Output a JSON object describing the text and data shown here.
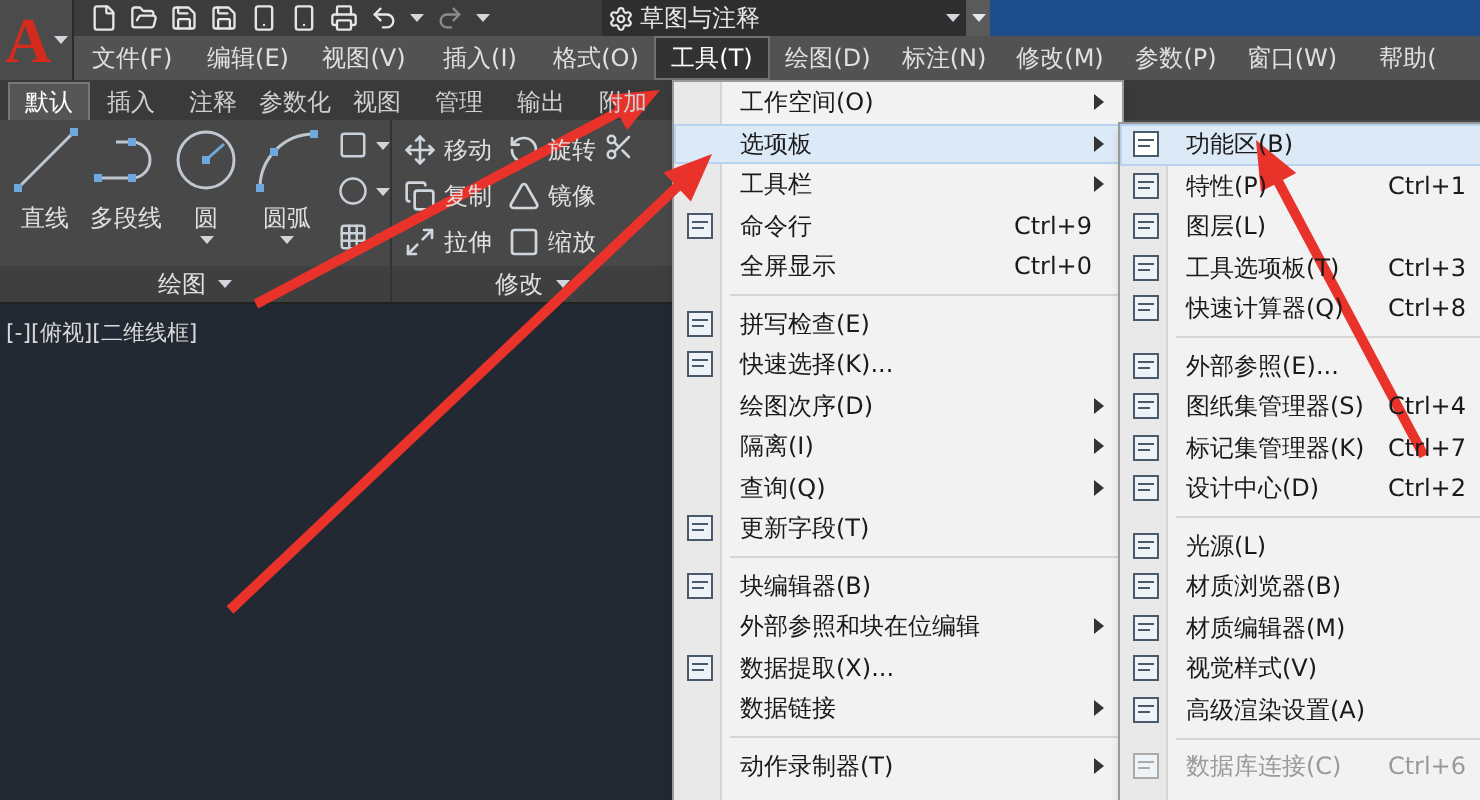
{
  "app_logo": "A",
  "workspace": "草图与注释",
  "menu_bar": [
    {
      "label": "文件(F)",
      "selected": false
    },
    {
      "label": "编辑(E)",
      "selected": false
    },
    {
      "label": "视图(V)",
      "selected": false
    },
    {
      "label": "插入(I)",
      "selected": false
    },
    {
      "label": "格式(O)",
      "selected": false
    },
    {
      "label": "工具(T)",
      "selected": true
    },
    {
      "label": "绘图(D)",
      "selected": false
    },
    {
      "label": "标注(N)",
      "selected": false
    },
    {
      "label": "修改(M)",
      "selected": false
    },
    {
      "label": "参数(P)",
      "selected": false
    },
    {
      "label": "窗口(W)",
      "selected": false
    },
    {
      "label": "帮助(",
      "selected": false
    }
  ],
  "ribbon_tabs": [
    {
      "label": "默认",
      "selected": true
    },
    {
      "label": "插入",
      "selected": false
    },
    {
      "label": "注释",
      "selected": false
    },
    {
      "label": "参数化",
      "selected": false
    },
    {
      "label": "视图",
      "selected": false
    },
    {
      "label": "管理",
      "selected": false
    },
    {
      "label": "输出",
      "selected": false
    },
    {
      "label": "附加",
      "selected": false
    }
  ],
  "draw_panel": {
    "title": "绘图",
    "large_tools": [
      {
        "kind": "line",
        "label": "直线",
        "dropdown": false
      },
      {
        "kind": "polyline",
        "label": "多段线",
        "dropdown": false
      },
      {
        "kind": "circle",
        "label": "圆",
        "dropdown": true
      },
      {
        "kind": "arc",
        "label": "圆弧",
        "dropdown": true
      }
    ]
  },
  "modify_panel": {
    "title": "修改",
    "tools": [
      {
        "kind": "move",
        "label": "移动"
      },
      {
        "kind": "rotate",
        "label": "旋转"
      },
      {
        "kind": "copy",
        "label": "复制"
      },
      {
        "kind": "mirror",
        "label": "镜像"
      },
      {
        "kind": "stretch",
        "label": "拉伸"
      },
      {
        "kind": "scale",
        "label": "缩放"
      }
    ]
  },
  "viewport_label": "[-][俯视][二维线框]",
  "tools_menu": {
    "groups": [
      [
        {
          "label": "工作空间(O)",
          "submenu": true,
          "has_icon": false,
          "selected": false,
          "disabled": false
        },
        {
          "label": "选项板",
          "submenu": true,
          "has_icon": false,
          "selected": true,
          "disabled": false
        },
        {
          "label": "工具栏",
          "submenu": true,
          "has_icon": false,
          "selected": false,
          "disabled": false
        },
        {
          "label": "命令行",
          "shortcut": "Ctrl+9",
          "submenu": false,
          "has_icon": true,
          "selected": false,
          "disabled": false
        },
        {
          "label": "全屏显示",
          "shortcut": "Ctrl+0",
          "submenu": false,
          "has_icon": false,
          "selected": false,
          "disabled": false
        }
      ],
      [
        {
          "label": "拼写检查(E)",
          "submenu": false,
          "has_icon": true,
          "selected": false,
          "disabled": false
        },
        {
          "label": "快速选择(K)...",
          "submenu": false,
          "has_icon": true,
          "selected": false,
          "disabled": false
        },
        {
          "label": "绘图次序(D)",
          "submenu": true,
          "has_icon": false,
          "selected": false,
          "disabled": false
        },
        {
          "label": "隔离(I)",
          "submenu": true,
          "has_icon": false,
          "selected": false,
          "disabled": false
        },
        {
          "label": "查询(Q)",
          "submenu": true,
          "has_icon": false,
          "selected": false,
          "disabled": false
        },
        {
          "label": "更新字段(T)",
          "submenu": false,
          "has_icon": true,
          "selected": false,
          "disabled": false
        }
      ],
      [
        {
          "label": "块编辑器(B)",
          "submenu": false,
          "has_icon": true,
          "selected": false,
          "disabled": false
        },
        {
          "label": "外部参照和块在位编辑",
          "submenu": true,
          "has_icon": false,
          "selected": false,
          "disabled": false
        },
        {
          "label": "数据提取(X)...",
          "submenu": false,
          "has_icon": true,
          "selected": false,
          "disabled": false
        },
        {
          "label": "数据链接",
          "submenu": true,
          "has_icon": false,
          "selected": false,
          "disabled": false
        }
      ],
      [
        {
          "label": "动作录制器(T)",
          "submenu": true,
          "has_icon": false,
          "selected": false,
          "disabled": false
        }
      ]
    ]
  },
  "palettes_submenu": {
    "groups": [
      [
        {
          "label": "功能区(B)",
          "submenu": false,
          "has_icon": true,
          "selected": true,
          "disabled": false
        },
        {
          "label": "特性(P)",
          "shortcut": "Ctrl+1",
          "submenu": false,
          "has_icon": true,
          "selected": false,
          "disabled": false
        },
        {
          "label": "图层(L)",
          "submenu": false,
          "has_icon": true,
          "selected": false,
          "disabled": false
        },
        {
          "label": "工具选项板(T)",
          "shortcut": "Ctrl+3",
          "submenu": false,
          "has_icon": true,
          "selected": false,
          "disabled": false
        },
        {
          "label": "快速计算器(Q)",
          "shortcut": "Ctrl+8",
          "submenu": false,
          "has_icon": true,
          "selected": false,
          "disabled": false
        }
      ],
      [
        {
          "label": "外部参照(E)...",
          "submenu": false,
          "has_icon": true,
          "selected": false,
          "disabled": false
        },
        {
          "label": "图纸集管理器(S)",
          "shortcut": "Ctrl+4",
          "submenu": false,
          "has_icon": true,
          "selected": false,
          "disabled": false
        },
        {
          "label": "标记集管理器(K)",
          "shortcut": "Ctrl+7",
          "submenu": false,
          "has_icon": true,
          "selected": false,
          "disabled": false
        },
        {
          "label": "设计中心(D)",
          "shortcut": "Ctrl+2",
          "submenu": false,
          "has_icon": true,
          "selected": false,
          "disabled": false
        }
      ],
      [
        {
          "label": "光源(L)",
          "submenu": false,
          "has_icon": true,
          "selected": false,
          "disabled": false
        },
        {
          "label": "材质浏览器(B)",
          "submenu": false,
          "has_icon": true,
          "selected": false,
          "disabled": false
        },
        {
          "label": "材质编辑器(M)",
          "submenu": false,
          "has_icon": true,
          "selected": false,
          "disabled": false
        },
        {
          "label": "视觉样式(V)",
          "submenu": false,
          "has_icon": true,
          "selected": false,
          "disabled": false
        },
        {
          "label": "高级渲染设置(A)",
          "submenu": false,
          "has_icon": true,
          "selected": false,
          "disabled": false
        }
      ],
      [
        {
          "label": "数据库连接(C)",
          "shortcut": "Ctrl+6",
          "submenu": false,
          "has_icon": true,
          "selected": false,
          "disabled": true
        }
      ]
    ]
  }
}
